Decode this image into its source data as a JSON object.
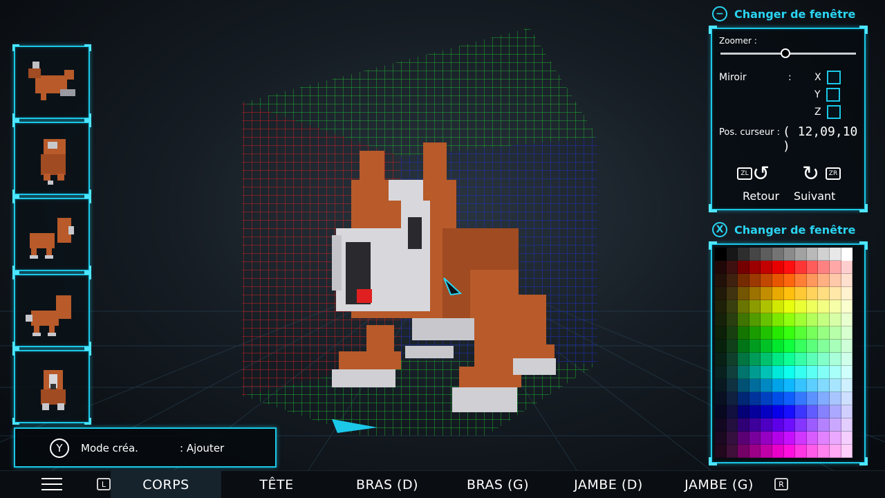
{
  "left_panel": {
    "thumbnails": [
      "top-view",
      "back-view",
      "side-view-right",
      "side-view-left",
      "front-view"
    ]
  },
  "mode": {
    "button": "Y",
    "label": "Mode créa.",
    "value": ": Ajouter"
  },
  "window_top": {
    "button": "−",
    "title": "Changer de fenêtre"
  },
  "settings": {
    "zoom_label": "Zoomer :",
    "zoom_level": 0.48,
    "mirror_label": "Miroir",
    "mirror_colon": ":",
    "axes": [
      {
        "label": "X",
        "checked": false
      },
      {
        "label": "Y",
        "checked": false
      },
      {
        "label": "Z",
        "checked": false
      }
    ],
    "pos_label": "Pos. curseur :",
    "pos_value": "( 12,09,10 )",
    "zl_label": "ZL",
    "zr_label": "ZR",
    "retour_label": "Retour",
    "suivant_label": "Suivant"
  },
  "window_bottom": {
    "button": "X",
    "title": "Changer de fenêtre"
  },
  "palette": {
    "selected": "#ffffff"
  },
  "tabbar": {
    "l_button": "L",
    "r_button": "R",
    "tabs": [
      "CORPS",
      "TÊTE",
      "BRAS (D)",
      "BRAS (G)",
      "JAMBE (D)",
      "JAMBE (G)"
    ],
    "active": "CORPS"
  },
  "colors": {
    "accent": "#1bc8e8",
    "grid_left": "#d02020",
    "grid_back": "#2030c0",
    "grid_floor": "#20b030",
    "dog_brown": "#b85a2a",
    "dog_white": "#d8d8dc"
  }
}
